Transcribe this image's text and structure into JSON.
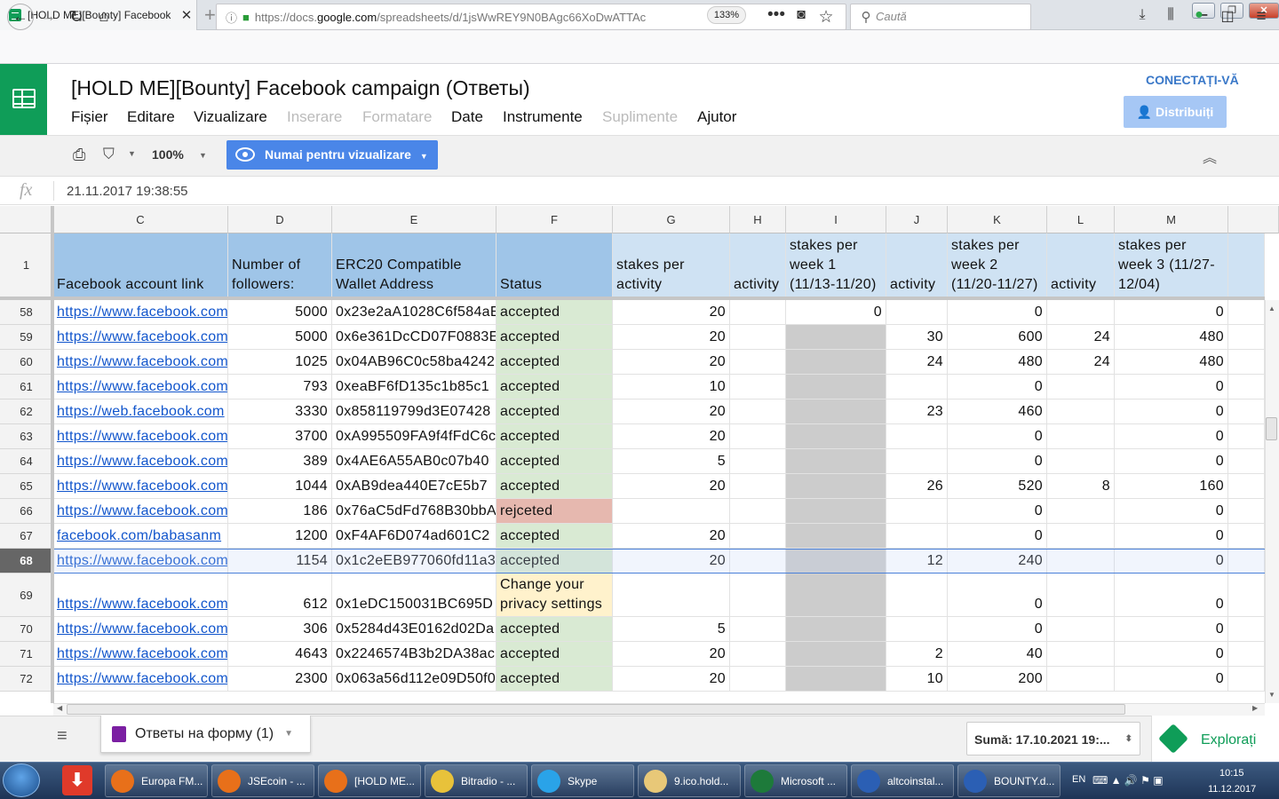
{
  "browser": {
    "tab_title": "[HOLD ME][Bounty] Facebook",
    "url_prefix": "https://docs.",
    "url_domain": "google.com",
    "url_rest": "/spreadsheets/d/1jsWwREY9N0BAgc66XoDwATTAc",
    "zoom": "133%",
    "search_placeholder": "Caută"
  },
  "app": {
    "doc_title": "[HOLD ME][Bounty] Facebook campaign (Ответы)",
    "menus": [
      {
        "label": "Fișier",
        "enabled": true
      },
      {
        "label": "Editare",
        "enabled": true
      },
      {
        "label": "Vizualizare",
        "enabled": true
      },
      {
        "label": "Inserare",
        "enabled": false
      },
      {
        "label": "Formatare",
        "enabled": false
      },
      {
        "label": "Date",
        "enabled": true
      },
      {
        "label": "Instrumente",
        "enabled": true
      },
      {
        "label": "Suplimente",
        "enabled": false
      },
      {
        "label": "Ajutor",
        "enabled": true
      }
    ],
    "connect_label": "CONECTAȚI-VĂ",
    "share_label": "Distribuiți"
  },
  "toolbar": {
    "zoom_label": "100%",
    "view_mode_label": "Numai pentru vizualizare"
  },
  "formula_bar": {
    "fx": "fx",
    "value": "21.11.2017 19:38:55"
  },
  "grid": {
    "columns": [
      "C",
      "D",
      "E",
      "F",
      "G",
      "H",
      "I",
      "J",
      "K",
      "L",
      "M"
    ],
    "header_row_number": "1",
    "headers": [
      "Facebook account link",
      "Number of followers:",
      "ERC20 Compatible Wallet Address",
      "Status",
      "stakes per activity",
      "activity",
      "stakes per week 1 (11/13-11/20)",
      "activity",
      "stakes per week 2 (11/20-11/27)",
      "activity",
      "stakes per week 3 (11/27-12/04)"
    ],
    "rows": [
      {
        "n": "58",
        "link": "https://www.facebook.com",
        "followers": "5000",
        "wallet": "0x23e2aA1028C6f584aE",
        "status": "accepted",
        "g": "20",
        "h": "",
        "i": "0",
        "j": "",
        "k": "0",
        "l": "",
        "m": "0"
      },
      {
        "n": "59",
        "link": "https://www.facebook.com",
        "followers": "5000",
        "wallet": "0x6e361DcCD07F0883E",
        "status": "accepted",
        "g": "20",
        "h": "",
        "i": "",
        "j": "30",
        "k": "600",
        "l": "24",
        "m": "480"
      },
      {
        "n": "60",
        "link": "https://www.facebook.com",
        "followers": "1025",
        "wallet": "0x04AB96C0c58ba4242",
        "status": "accepted",
        "g": "20",
        "h": "",
        "i": "",
        "j": "24",
        "k": "480",
        "l": "24",
        "m": "480"
      },
      {
        "n": "61",
        "link": "https://www.facebook.com",
        "followers": "793",
        "wallet": "0xeaBF6fD135c1b85c1",
        "status": "accepted",
        "g": "10",
        "h": "",
        "i": "",
        "j": "",
        "k": "0",
        "l": "",
        "m": "0"
      },
      {
        "n": "62",
        "link": "https://web.facebook.com",
        "followers": "3330",
        "wallet": "0x858119799d3E07428",
        "status": "accepted",
        "g": "20",
        "h": "",
        "i": "",
        "j": "23",
        "k": "460",
        "l": "",
        "m": "0"
      },
      {
        "n": "63",
        "link": "https://www.facebook.com",
        "followers": "3700",
        "wallet": "0xA995509FA9f4fFdC6c",
        "status": "accepted",
        "g": "20",
        "h": "",
        "i": "",
        "j": "",
        "k": "0",
        "l": "",
        "m": "0"
      },
      {
        "n": "64",
        "link": "https://www.facebook.com",
        "followers": "389",
        "wallet": "0x4AE6A55AB0c07b40",
        "status": "accepted",
        "g": "5",
        "h": "",
        "i": "",
        "j": "",
        "k": "0",
        "l": "",
        "m": "0"
      },
      {
        "n": "65",
        "link": "https://www.facebook.com",
        "followers": "1044",
        "wallet": "0xAB9dea440E7cE5b7",
        "status": "accepted",
        "g": "20",
        "h": "",
        "i": "",
        "j": "26",
        "k": "520",
        "l": "8",
        "m": "160"
      },
      {
        "n": "66",
        "link": "https://www.facebook.com",
        "followers": "186",
        "wallet": "0x76aC5dFd768B30bbA",
        "status": "rejceted",
        "g": "",
        "h": "",
        "i": "",
        "j": "",
        "k": "0",
        "l": "",
        "m": "0"
      },
      {
        "n": "67",
        "link": "facebook.com/babasanm",
        "followers": "1200",
        "wallet": "0xF4AF6D074ad601C2",
        "status": "accepted",
        "g": "20",
        "h": "",
        "i": "",
        "j": "",
        "k": "0",
        "l": "",
        "m": "0"
      },
      {
        "n": "68",
        "link": "https://www.facebook.com",
        "followers": "1154",
        "wallet": "0x1c2eEB977060fd11a3",
        "status": "accepted",
        "g": "20",
        "h": "",
        "i": "",
        "j": "12",
        "k": "240",
        "l": "",
        "m": "0"
      },
      {
        "n": "69",
        "link": "https://www.facebook.com",
        "followers": "612",
        "wallet": "0x1eDC150031BC695D",
        "status": "Change your privacy settings",
        "g": "",
        "h": "",
        "i": "",
        "j": "",
        "k": "0",
        "l": "",
        "m": "0"
      },
      {
        "n": "70",
        "link": "https://www.facebook.com",
        "followers": "306",
        "wallet": "0x5284d43E0162d02Da",
        "status": "accepted",
        "g": "5",
        "h": "",
        "i": "",
        "j": "",
        "k": "0",
        "l": "",
        "m": "0"
      },
      {
        "n": "71",
        "link": "https://www.facebook.com",
        "followers": "4643",
        "wallet": "0x2246574B3b2DA38ac",
        "status": "accepted",
        "g": "20",
        "h": "",
        "i": "",
        "j": "2",
        "k": "40",
        "l": "",
        "m": "0"
      },
      {
        "n": "72",
        "link": "https://www.facebook.com",
        "followers": "2300",
        "wallet": "0x063a56d112e09D50f0",
        "status": "accepted",
        "g": "20",
        "h": "",
        "i": "",
        "j": "10",
        "k": "200",
        "l": "",
        "m": "0"
      }
    ],
    "selected_row": "68"
  },
  "sheets": {
    "tab_label": "Ответы на форму (1)",
    "sum_label": "Sumă: 17.10.2021 19:...",
    "explore_label": "Explorați"
  },
  "taskbar": {
    "items": [
      {
        "label": "Europa FM...",
        "color": "#e8701a"
      },
      {
        "label": "JSEcoin - ...",
        "color": "#e8701a"
      },
      {
        "label": "[HOLD ME...",
        "color": "#e8701a"
      },
      {
        "label": "Bitradio - ...",
        "color": "#e8c23a"
      },
      {
        "label": "Skype",
        "color": "#2aa3e8"
      },
      {
        "label": "9.ico.hold...",
        "color": "#e8c878"
      },
      {
        "label": "Microsoft ...",
        "color": "#1d7a3a"
      },
      {
        "label": "altcoinstal...",
        "color": "#2b5fb4"
      },
      {
        "label": "BOUNTY.d...",
        "color": "#2b5fb4"
      }
    ],
    "lang": "EN",
    "time": "10:15",
    "date": "11.12.2017"
  }
}
